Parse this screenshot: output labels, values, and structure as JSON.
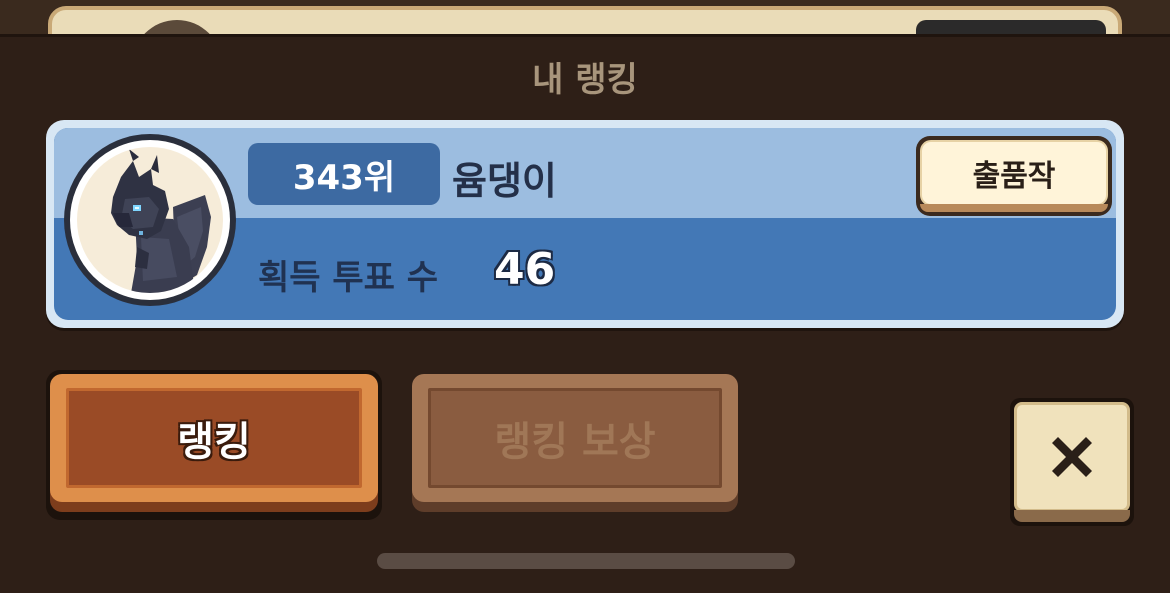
{
  "sheet": {
    "title": "내 랭킹"
  },
  "my_rank": {
    "rank": "343위",
    "player_name": "윰댕이",
    "work_button_label": "출품작",
    "votes_label": "획득 투표 수",
    "votes_value": "46",
    "avatar_icon": "dragon-character-icon"
  },
  "actions": {
    "ranking_label": "랭킹",
    "reward_label": "랭킹 보상",
    "close_icon": "close-icon"
  },
  "colors": {
    "card_blue": "#4378b6",
    "card_light_blue": "#9cbde0",
    "ranking_orange": "#de8f4b",
    "background_brown": "#2e1f17"
  }
}
